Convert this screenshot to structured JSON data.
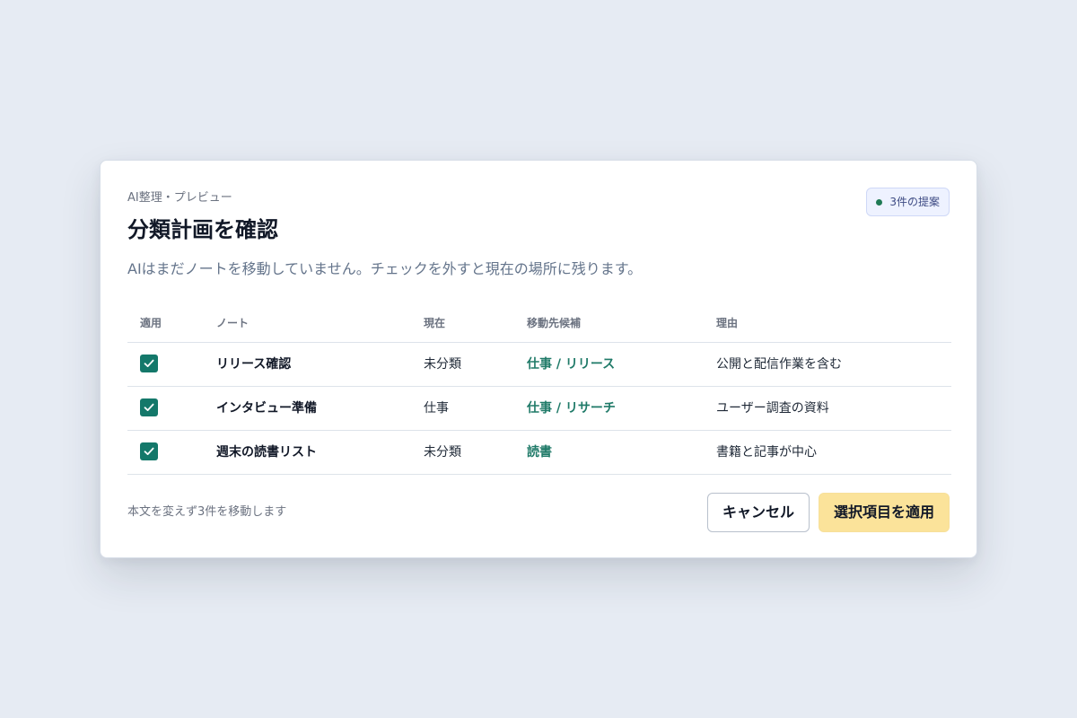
{
  "dialog": {
    "eyebrow": "AI整理・プレビュー",
    "title": "分類計画を確認",
    "description": "AIはまだノートを移動していません。チェックを外すと現在の場所に残ります。",
    "badge": {
      "label": "3件の提案",
      "dot_color": "#1f7a55"
    }
  },
  "table": {
    "headers": {
      "apply": "適用",
      "note": "ノート",
      "current": "現在",
      "target": "移動先候補",
      "reason": "理由"
    },
    "rows": [
      {
        "checked": true,
        "note": "リリース確認",
        "current": "未分類",
        "target": "仕事 / リリース",
        "reason": "公開と配信作業を含む"
      },
      {
        "checked": true,
        "note": "インタビュー準備",
        "current": "仕事",
        "target": "仕事 / リサーチ",
        "reason": "ユーザー調査の資料"
      },
      {
        "checked": true,
        "note": "週末の読書リスト",
        "current": "未分類",
        "target": "読書",
        "reason": "書籍と記事が中心"
      }
    ]
  },
  "footer": {
    "summary": "本文を変えず3件を移動します",
    "cancel_label": "キャンセル",
    "apply_label": "選択項目を適用"
  },
  "colors": {
    "background": "#e6ebf3",
    "accent_green": "#14786a",
    "target_green": "#1f7a68",
    "apply_button": "#fbe39a",
    "badge_background": "#eef2ff"
  },
  "icons": {
    "checkbox": "check-icon",
    "badge_dot": "status-dot-icon"
  }
}
